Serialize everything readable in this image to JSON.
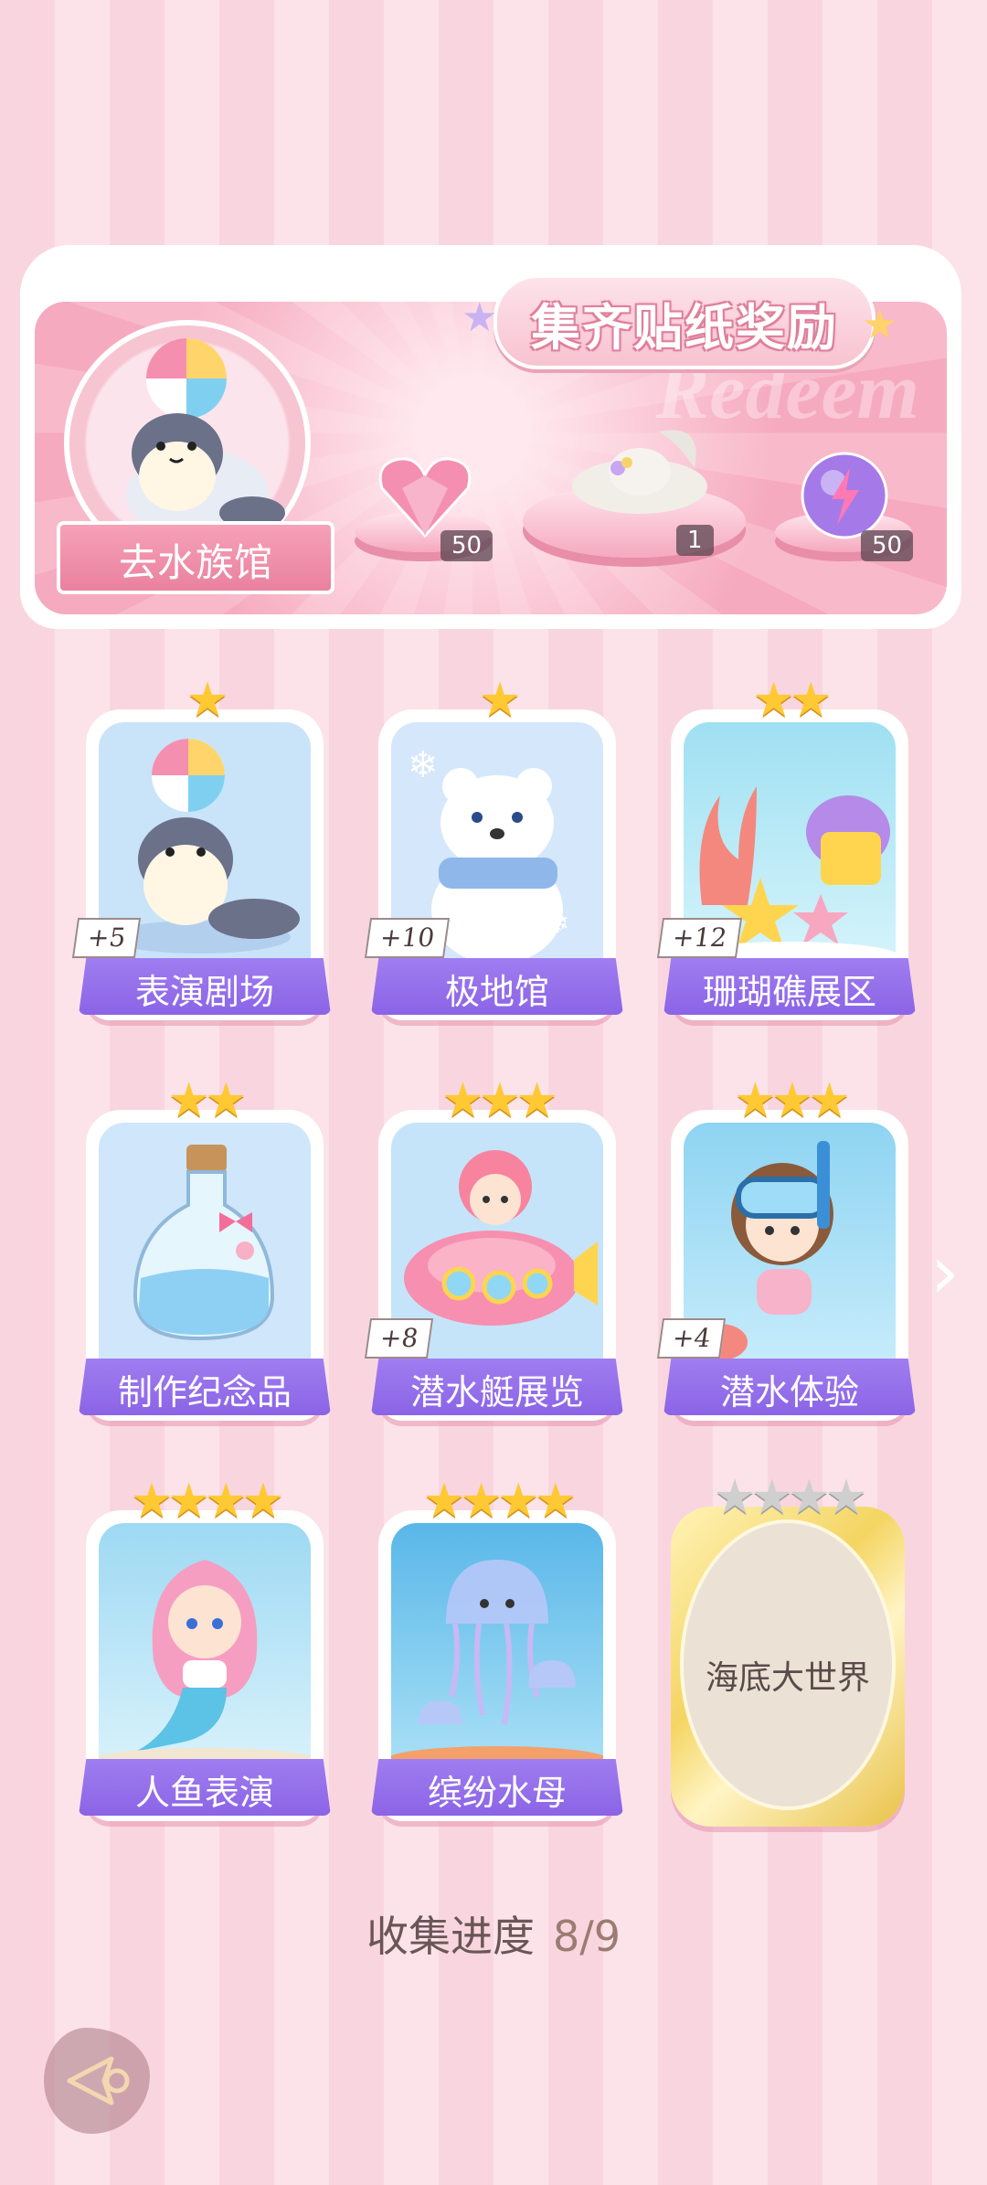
{
  "banner": {
    "title": "集齐贴纸奖励",
    "watermark": "Redeem",
    "venue_label": "去水族馆",
    "rewards": [
      {
        "icon": "pink-heart-gem-icon",
        "count": "50"
      },
      {
        "icon": "feather-hat-icon",
        "count": "1"
      },
      {
        "icon": "energy-orb-icon",
        "count": "50"
      }
    ]
  },
  "cards": [
    {
      "name": "表演剧场",
      "stars": "★",
      "bonus": "+5"
    },
    {
      "name": "极地馆",
      "stars": "★",
      "bonus": "+10"
    },
    {
      "name": "珊瑚礁展区",
      "stars": "★★",
      "bonus": "+12"
    },
    {
      "name": "制作纪念品",
      "stars": "★★",
      "bonus": ""
    },
    {
      "name": "潜水艇展览",
      "stars": "★★★",
      "bonus": "+8"
    },
    {
      "name": "潜水体验",
      "stars": "★★★",
      "bonus": "+4"
    },
    {
      "name": "人鱼表演",
      "stars": "★★★★",
      "bonus": ""
    },
    {
      "name": "缤纷水母",
      "stars": "★★★★",
      "bonus": ""
    },
    {
      "name": "海底大世界",
      "stars": "★★★★",
      "bonus": "",
      "locked": true
    }
  ],
  "progress": {
    "label": "收集进度",
    "value": "8/9"
  },
  "colors": {
    "accent": "#9b75ec",
    "pink": "#f7a1b8",
    "star": "#ffc933"
  }
}
